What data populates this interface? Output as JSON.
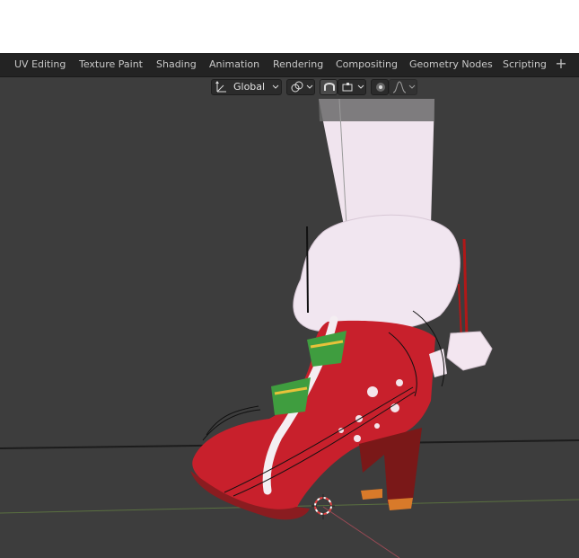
{
  "tabs": [
    {
      "label": "UV Editing"
    },
    {
      "label": "Texture Paint"
    },
    {
      "label": "Shading"
    },
    {
      "label": "Animation"
    },
    {
      "label": "Rendering"
    },
    {
      "label": "Compositing"
    },
    {
      "label": "Geometry Nodes"
    },
    {
      "label": "Scripting"
    }
  ],
  "add_tab_glyph": "+",
  "header": {
    "orientation_label": "Global",
    "orientation_icon": "transform-orientation-icon",
    "pivot_icon": "pivot-icon",
    "snap_icon": "magnet-icon",
    "snap_target_icon": "snap-target-icon",
    "proportional_icon": "proportional-edit-icon",
    "falloff_icon": "falloff-curve-icon"
  },
  "colors": {
    "tab_bg": "#232323",
    "viewport_bg": "#3d3d3d",
    "boot_red": "#c8202c",
    "fur_white": "#f1e6f0",
    "ribbon_green": "#3f9d3f",
    "cursor_red": "#e04040"
  }
}
